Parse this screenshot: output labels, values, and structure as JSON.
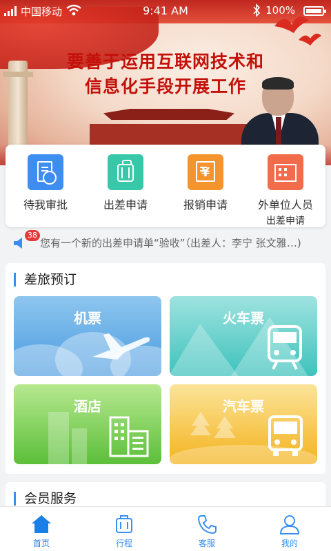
{
  "status_bar": {
    "carrier": "中国移动",
    "time": "9:41 AM",
    "battery": "100%"
  },
  "banner": {
    "headline_line1": "要善于运用互联网技术和",
    "headline_line2": "信息化手段开展工作"
  },
  "quick_actions": [
    {
      "label": "待我审批",
      "sub": "",
      "icon": "approval-icon",
      "color": "#3d8ef0"
    },
    {
      "label": "出差申请",
      "sub": "",
      "icon": "suitcase-icon",
      "color": "#36c8a8"
    },
    {
      "label": "报销申请",
      "sub": "",
      "icon": "reimburse-icon",
      "color": "#f5932d"
    },
    {
      "label": "外单位人员",
      "sub": "出差申请",
      "icon": "building-icon",
      "color": "#f26b4b"
    }
  ],
  "notice": {
    "count": "38",
    "text": "您有一个新的出差申请单“验收”（出差人：李宁 张文雅…)"
  },
  "travel": {
    "title": "差旅预订",
    "tiles": [
      {
        "label": "机票",
        "icon": "plane-icon"
      },
      {
        "label": "火车票",
        "icon": "train-icon"
      },
      {
        "label": "酒店",
        "icon": "hotel-icon"
      },
      {
        "label": "汽车票",
        "icon": "bus-icon"
      }
    ]
  },
  "member": {
    "title": "会员服务"
  },
  "tabbar": [
    {
      "label": "首页",
      "icon": "home-icon",
      "active": true
    },
    {
      "label": "行程",
      "icon": "itinerary-icon",
      "active": false
    },
    {
      "label": "客服",
      "icon": "phone-icon",
      "active": false
    },
    {
      "label": "我的",
      "icon": "profile-icon",
      "active": false
    }
  ],
  "colors": {
    "accent": "#3a8ff0",
    "badge": "#e23b3b",
    "headline": "#c3110a"
  }
}
